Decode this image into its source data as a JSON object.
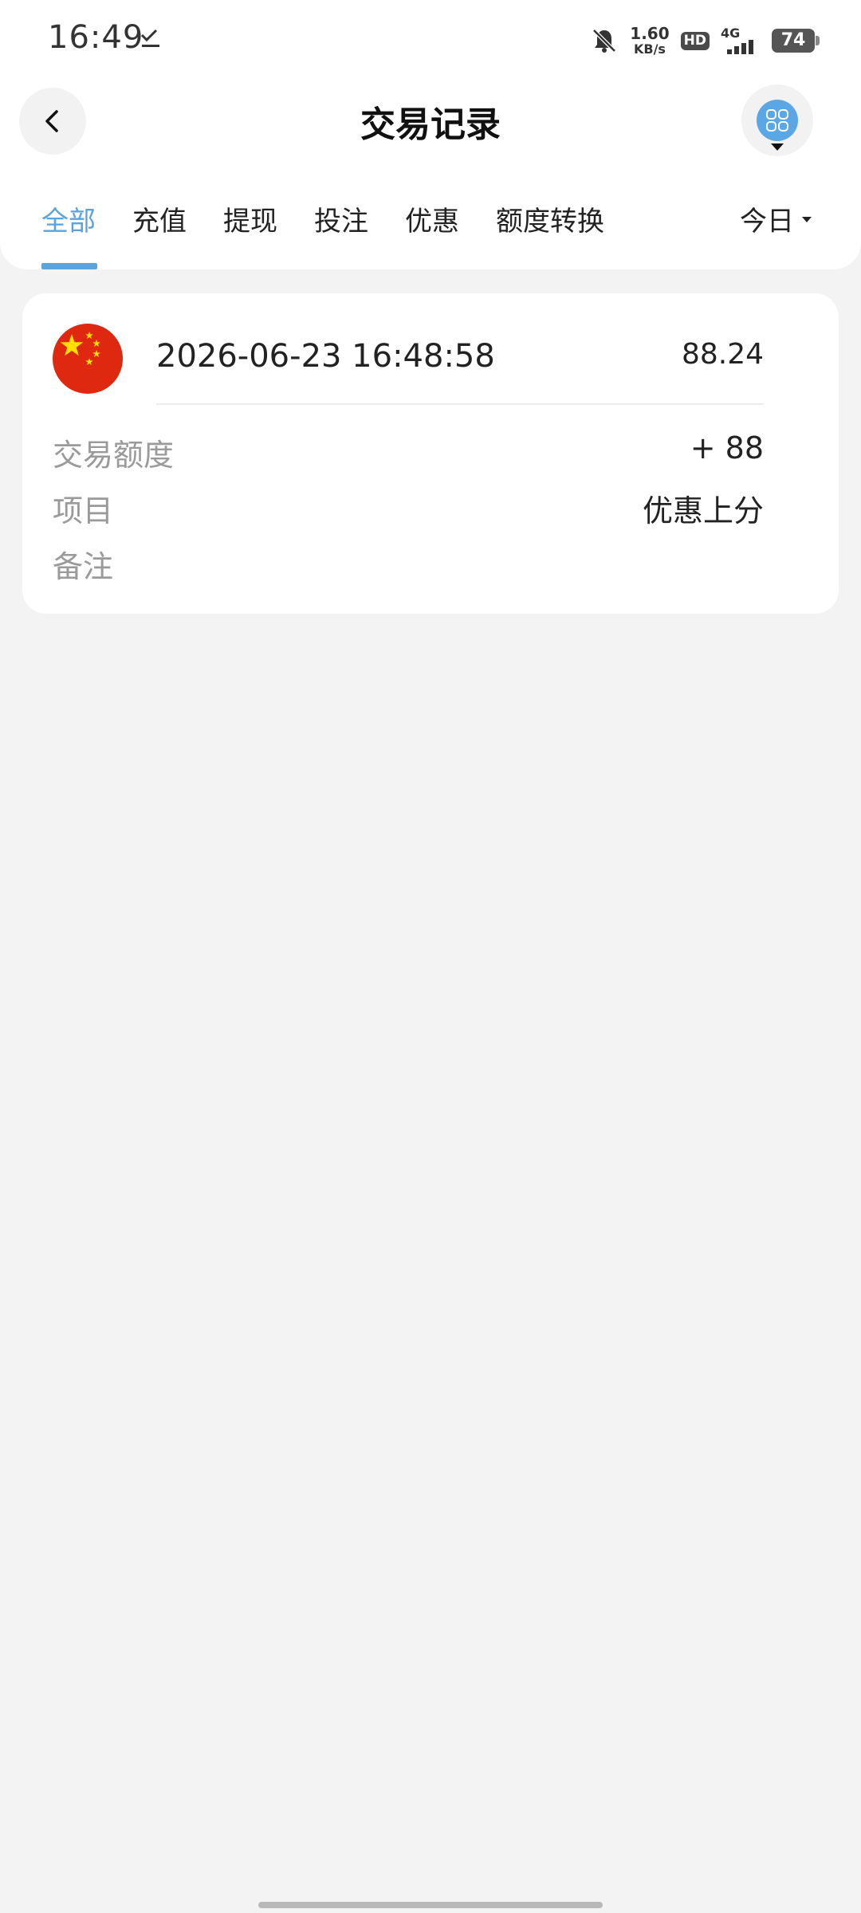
{
  "status_bar": {
    "time": "16:49",
    "net_speed_value": "1.60",
    "net_speed_unit": "KB/s",
    "hd_label": "HD",
    "network_label": "4G",
    "battery": "74"
  },
  "header": {
    "title": "交易记录"
  },
  "tabs": [
    {
      "label": "全部",
      "active": true
    },
    {
      "label": "充值",
      "active": false
    },
    {
      "label": "提现",
      "active": false
    },
    {
      "label": "投注",
      "active": false
    },
    {
      "label": "优惠",
      "active": false
    },
    {
      "label": "额度转换",
      "active": false
    }
  ],
  "date_filter": {
    "label": "今日"
  },
  "transactions": [
    {
      "time": "2026-06-23 16:48:58",
      "balance": "88.24",
      "amount_label": "交易额度",
      "amount_value": "+ 88",
      "item_label": "项目",
      "item_value": "优惠上分",
      "note_label": "备注",
      "note_value": ""
    }
  ],
  "colors": {
    "accent": "#5aa3dd",
    "background": "#f3f3f3",
    "card": "#ffffff",
    "muted_text": "#9a9a9a"
  },
  "icons": {
    "back": "chevron-left-icon",
    "menu": "grid-menu-icon",
    "flag": "china-flag-icon",
    "download_done": "download-check-icon",
    "notifications_off": "bell-off-icon"
  }
}
